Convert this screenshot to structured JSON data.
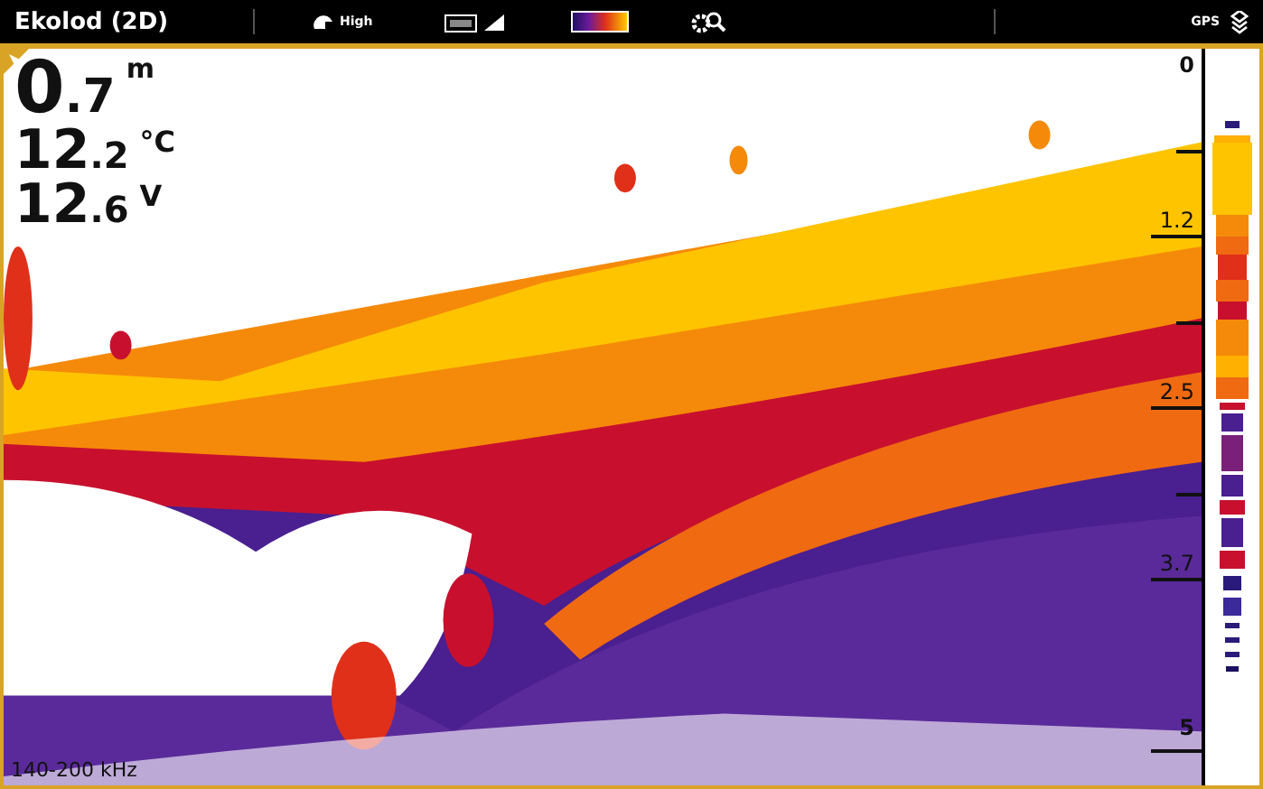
{
  "top_bar": {
    "title": "Ekolod (2D)",
    "sensitivity": "High",
    "gps": "GPS"
  },
  "readouts": [
    {
      "kind": "depth",
      "integer": "0",
      "fraction": ".7",
      "unit": "m"
    },
    {
      "kind": "temperature",
      "integer": "12",
      "fraction": ".2",
      "unit": "°C"
    },
    {
      "kind": "voltage",
      "integer": "12",
      "fraction": ".6",
      "unit": "V"
    }
  ],
  "depth_scale": [
    "0",
    "1.2",
    "2.5",
    "3.7",
    "5"
  ],
  "frequency": "140-200 kHz"
}
